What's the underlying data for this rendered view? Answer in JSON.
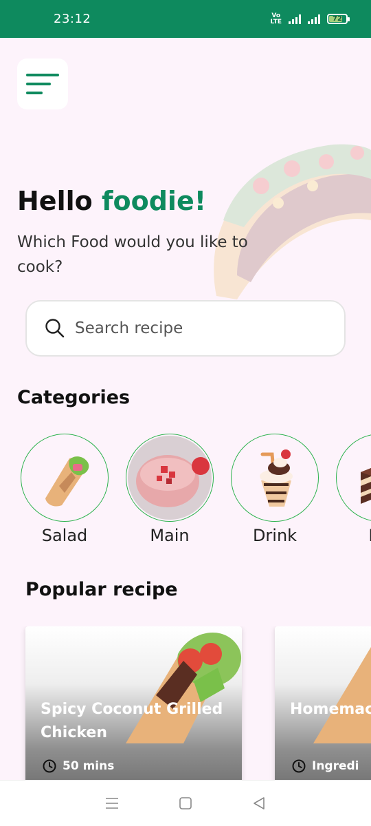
{
  "status_bar": {
    "time": "23:12",
    "network": "Vo LTE",
    "battery": "72",
    "battery_level": 0.72
  },
  "header": {
    "menu_icon": "hamburger-menu-icon",
    "greeting": "Hello",
    "greeting_accent": "foodie!",
    "subtitle": "Which Food would you like to cook?"
  },
  "search": {
    "placeholder": "Search recipe",
    "icon": "search-icon"
  },
  "categories": {
    "title": "Categories",
    "items": [
      {
        "label": "Salad",
        "icon": "wrap-icon"
      },
      {
        "label": "Main",
        "icon": "smoothie-bowl-icon"
      },
      {
        "label": "Drink",
        "icon": "milkshake-icon"
      },
      {
        "label": "De",
        "icon": "cake-icon"
      }
    ]
  },
  "popular": {
    "title": "Popular recipe",
    "cards": [
      {
        "title": "Spicy Coconut Grilled Chicken",
        "meta": "50 mins",
        "meta_icon": "clock-icon"
      },
      {
        "title": "Homemac Creamsic",
        "meta": "Ingredi",
        "meta_icon": "clock-icon"
      }
    ]
  },
  "nav_bar": {
    "items": [
      "recents-icon",
      "home-icon",
      "back-icon"
    ]
  },
  "colors": {
    "brand_green": "#0e8a5e",
    "background": "#fdf3fb",
    "category_border": "#2bb24c"
  }
}
